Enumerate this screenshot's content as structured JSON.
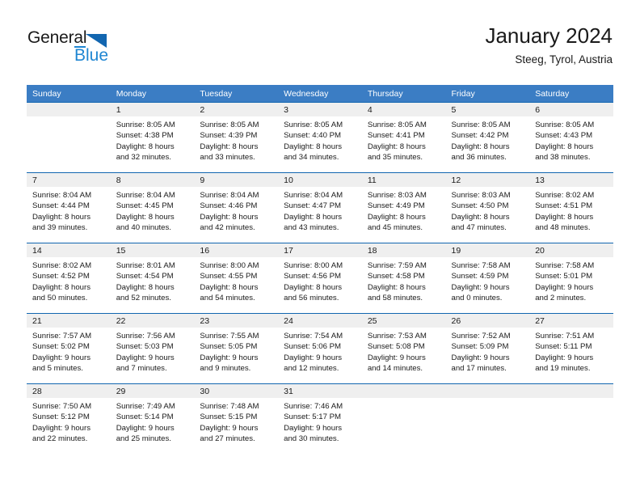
{
  "brand": {
    "name_part1": "General",
    "name_part2": "Blue",
    "accent_color": "#1f86d2",
    "triangle_color": "#1266b0"
  },
  "header": {
    "title": "January 2024",
    "subtitle": "Steeg, Tyrol, Austria"
  },
  "theme": {
    "header_row_bg": "#3b7dc4",
    "row_divider": "#1266b0",
    "daynum_band_bg": "#efefef"
  },
  "weekdays": [
    "Sunday",
    "Monday",
    "Tuesday",
    "Wednesday",
    "Thursday",
    "Friday",
    "Saturday"
  ],
  "weeks": [
    [
      {
        "day": "",
        "sunrise": "",
        "sunset": "",
        "daylight_line1": "",
        "daylight_line2": ""
      },
      {
        "day": "1",
        "sunrise": "Sunrise: 8:05 AM",
        "sunset": "Sunset: 4:38 PM",
        "daylight_line1": "Daylight: 8 hours",
        "daylight_line2": "and 32 minutes."
      },
      {
        "day": "2",
        "sunrise": "Sunrise: 8:05 AM",
        "sunset": "Sunset: 4:39 PM",
        "daylight_line1": "Daylight: 8 hours",
        "daylight_line2": "and 33 minutes."
      },
      {
        "day": "3",
        "sunrise": "Sunrise: 8:05 AM",
        "sunset": "Sunset: 4:40 PM",
        "daylight_line1": "Daylight: 8 hours",
        "daylight_line2": "and 34 minutes."
      },
      {
        "day": "4",
        "sunrise": "Sunrise: 8:05 AM",
        "sunset": "Sunset: 4:41 PM",
        "daylight_line1": "Daylight: 8 hours",
        "daylight_line2": "and 35 minutes."
      },
      {
        "day": "5",
        "sunrise": "Sunrise: 8:05 AM",
        "sunset": "Sunset: 4:42 PM",
        "daylight_line1": "Daylight: 8 hours",
        "daylight_line2": "and 36 minutes."
      },
      {
        "day": "6",
        "sunrise": "Sunrise: 8:05 AM",
        "sunset": "Sunset: 4:43 PM",
        "daylight_line1": "Daylight: 8 hours",
        "daylight_line2": "and 38 minutes."
      }
    ],
    [
      {
        "day": "7",
        "sunrise": "Sunrise: 8:04 AM",
        "sunset": "Sunset: 4:44 PM",
        "daylight_line1": "Daylight: 8 hours",
        "daylight_line2": "and 39 minutes."
      },
      {
        "day": "8",
        "sunrise": "Sunrise: 8:04 AM",
        "sunset": "Sunset: 4:45 PM",
        "daylight_line1": "Daylight: 8 hours",
        "daylight_line2": "and 40 minutes."
      },
      {
        "day": "9",
        "sunrise": "Sunrise: 8:04 AM",
        "sunset": "Sunset: 4:46 PM",
        "daylight_line1": "Daylight: 8 hours",
        "daylight_line2": "and 42 minutes."
      },
      {
        "day": "10",
        "sunrise": "Sunrise: 8:04 AM",
        "sunset": "Sunset: 4:47 PM",
        "daylight_line1": "Daylight: 8 hours",
        "daylight_line2": "and 43 minutes."
      },
      {
        "day": "11",
        "sunrise": "Sunrise: 8:03 AM",
        "sunset": "Sunset: 4:49 PM",
        "daylight_line1": "Daylight: 8 hours",
        "daylight_line2": "and 45 minutes."
      },
      {
        "day": "12",
        "sunrise": "Sunrise: 8:03 AM",
        "sunset": "Sunset: 4:50 PM",
        "daylight_line1": "Daylight: 8 hours",
        "daylight_line2": "and 47 minutes."
      },
      {
        "day": "13",
        "sunrise": "Sunrise: 8:02 AM",
        "sunset": "Sunset: 4:51 PM",
        "daylight_line1": "Daylight: 8 hours",
        "daylight_line2": "and 48 minutes."
      }
    ],
    [
      {
        "day": "14",
        "sunrise": "Sunrise: 8:02 AM",
        "sunset": "Sunset: 4:52 PM",
        "daylight_line1": "Daylight: 8 hours",
        "daylight_line2": "and 50 minutes."
      },
      {
        "day": "15",
        "sunrise": "Sunrise: 8:01 AM",
        "sunset": "Sunset: 4:54 PM",
        "daylight_line1": "Daylight: 8 hours",
        "daylight_line2": "and 52 minutes."
      },
      {
        "day": "16",
        "sunrise": "Sunrise: 8:00 AM",
        "sunset": "Sunset: 4:55 PM",
        "daylight_line1": "Daylight: 8 hours",
        "daylight_line2": "and 54 minutes."
      },
      {
        "day": "17",
        "sunrise": "Sunrise: 8:00 AM",
        "sunset": "Sunset: 4:56 PM",
        "daylight_line1": "Daylight: 8 hours",
        "daylight_line2": "and 56 minutes."
      },
      {
        "day": "18",
        "sunrise": "Sunrise: 7:59 AM",
        "sunset": "Sunset: 4:58 PM",
        "daylight_line1": "Daylight: 8 hours",
        "daylight_line2": "and 58 minutes."
      },
      {
        "day": "19",
        "sunrise": "Sunrise: 7:58 AM",
        "sunset": "Sunset: 4:59 PM",
        "daylight_line1": "Daylight: 9 hours",
        "daylight_line2": "and 0 minutes."
      },
      {
        "day": "20",
        "sunrise": "Sunrise: 7:58 AM",
        "sunset": "Sunset: 5:01 PM",
        "daylight_line1": "Daylight: 9 hours",
        "daylight_line2": "and 2 minutes."
      }
    ],
    [
      {
        "day": "21",
        "sunrise": "Sunrise: 7:57 AM",
        "sunset": "Sunset: 5:02 PM",
        "daylight_line1": "Daylight: 9 hours",
        "daylight_line2": "and 5 minutes."
      },
      {
        "day": "22",
        "sunrise": "Sunrise: 7:56 AM",
        "sunset": "Sunset: 5:03 PM",
        "daylight_line1": "Daylight: 9 hours",
        "daylight_line2": "and 7 minutes."
      },
      {
        "day": "23",
        "sunrise": "Sunrise: 7:55 AM",
        "sunset": "Sunset: 5:05 PM",
        "daylight_line1": "Daylight: 9 hours",
        "daylight_line2": "and 9 minutes."
      },
      {
        "day": "24",
        "sunrise": "Sunrise: 7:54 AM",
        "sunset": "Sunset: 5:06 PM",
        "daylight_line1": "Daylight: 9 hours",
        "daylight_line2": "and 12 minutes."
      },
      {
        "day": "25",
        "sunrise": "Sunrise: 7:53 AM",
        "sunset": "Sunset: 5:08 PM",
        "daylight_line1": "Daylight: 9 hours",
        "daylight_line2": "and 14 minutes."
      },
      {
        "day": "26",
        "sunrise": "Sunrise: 7:52 AM",
        "sunset": "Sunset: 5:09 PM",
        "daylight_line1": "Daylight: 9 hours",
        "daylight_line2": "and 17 minutes."
      },
      {
        "day": "27",
        "sunrise": "Sunrise: 7:51 AM",
        "sunset": "Sunset: 5:11 PM",
        "daylight_line1": "Daylight: 9 hours",
        "daylight_line2": "and 19 minutes."
      }
    ],
    [
      {
        "day": "28",
        "sunrise": "Sunrise: 7:50 AM",
        "sunset": "Sunset: 5:12 PM",
        "daylight_line1": "Daylight: 9 hours",
        "daylight_line2": "and 22 minutes."
      },
      {
        "day": "29",
        "sunrise": "Sunrise: 7:49 AM",
        "sunset": "Sunset: 5:14 PM",
        "daylight_line1": "Daylight: 9 hours",
        "daylight_line2": "and 25 minutes."
      },
      {
        "day": "30",
        "sunrise": "Sunrise: 7:48 AM",
        "sunset": "Sunset: 5:15 PM",
        "daylight_line1": "Daylight: 9 hours",
        "daylight_line2": "and 27 minutes."
      },
      {
        "day": "31",
        "sunrise": "Sunrise: 7:46 AM",
        "sunset": "Sunset: 5:17 PM",
        "daylight_line1": "Daylight: 9 hours",
        "daylight_line2": "and 30 minutes."
      },
      {
        "day": "",
        "sunrise": "",
        "sunset": "",
        "daylight_line1": "",
        "daylight_line2": ""
      },
      {
        "day": "",
        "sunrise": "",
        "sunset": "",
        "daylight_line1": "",
        "daylight_line2": ""
      },
      {
        "day": "",
        "sunrise": "",
        "sunset": "",
        "daylight_line1": "",
        "daylight_line2": ""
      }
    ]
  ]
}
